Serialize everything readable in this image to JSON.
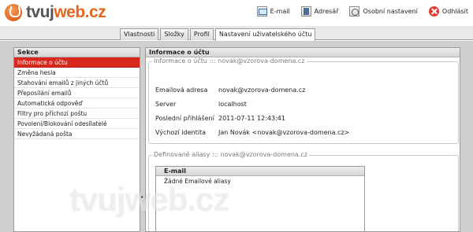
{
  "brand": {
    "logo_text_prefix": "tvuj",
    "logo_text_suffix": "web.cz",
    "accent_color": "#e4661e"
  },
  "header": {
    "links": [
      {
        "label": "E-mail",
        "icon": "mail-icon"
      },
      {
        "label": "Adresář",
        "icon": "address-book-icon"
      },
      {
        "label": "Osobní nastavení",
        "icon": "settings-icon"
      },
      {
        "label": "Odhlásit",
        "icon": "logout-icon"
      }
    ]
  },
  "tabs": [
    {
      "label": "Vlastnosti",
      "active": false
    },
    {
      "label": "Složky",
      "active": false
    },
    {
      "label": "Profil",
      "active": false
    },
    {
      "label": "Nastavení uživatelského účtu",
      "active": true
    }
  ],
  "sidebar": {
    "title": "Sekce",
    "items": [
      {
        "label": "Informace o účtu",
        "active": true
      },
      {
        "label": "Změna hesla",
        "active": false
      },
      {
        "label": "Stahování emailů z jiných účtů",
        "active": false
      },
      {
        "label": "Přeposílání emailů",
        "active": false
      },
      {
        "label": "Automatická odpověď",
        "active": false
      },
      {
        "label": "Filtry pro příchozí poštu",
        "active": false
      },
      {
        "label": "Povolení/Blokování odesílatelé",
        "active": false
      },
      {
        "label": "Nevyžádaná pošta",
        "active": false
      }
    ],
    "active_color": "#d8271c"
  },
  "main": {
    "title": "Informace o účtu",
    "info_legend": "Informace o účtu ::: novak@vzorova-domena.cz",
    "info": [
      {
        "label": "Emailová adresa",
        "value": "novak@vzorova-domena.cz"
      },
      {
        "label": "Server",
        "value": "localhost"
      },
      {
        "label": "Poslední přihlášení",
        "value": "2011-07-11 12:43:41"
      },
      {
        "label": "Výchozí identita",
        "value": "Jan Novák <novak@vzorova-domena.cz>"
      }
    ],
    "alias_legend": "Definované aliasy ::: novak@vzorova-domena.cz",
    "alias_grid": {
      "header": "E-mail",
      "rows": [
        "Žádné Emailové aliasy"
      ]
    }
  },
  "watermark": "tvujweb.cz"
}
